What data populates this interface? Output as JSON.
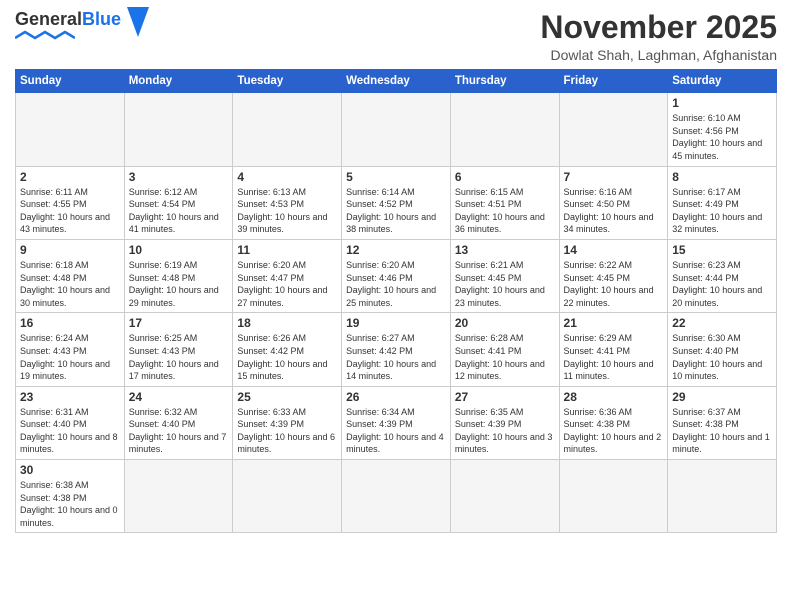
{
  "header": {
    "logo_text_regular": "General",
    "logo_text_blue": "Blue",
    "month_title": "November 2025",
    "subtitle": "Dowlat Shah, Laghman, Afghanistan"
  },
  "weekdays": [
    "Sunday",
    "Monday",
    "Tuesday",
    "Wednesday",
    "Thursday",
    "Friday",
    "Saturday"
  ],
  "weeks": [
    [
      {
        "day": "",
        "info": ""
      },
      {
        "day": "",
        "info": ""
      },
      {
        "day": "",
        "info": ""
      },
      {
        "day": "",
        "info": ""
      },
      {
        "day": "",
        "info": ""
      },
      {
        "day": "",
        "info": ""
      },
      {
        "day": "1",
        "info": "Sunrise: 6:10 AM\nSunset: 4:56 PM\nDaylight: 10 hours\nand 45 minutes."
      }
    ],
    [
      {
        "day": "2",
        "info": "Sunrise: 6:11 AM\nSunset: 4:55 PM\nDaylight: 10 hours\nand 43 minutes."
      },
      {
        "day": "3",
        "info": "Sunrise: 6:12 AM\nSunset: 4:54 PM\nDaylight: 10 hours\nand 41 minutes."
      },
      {
        "day": "4",
        "info": "Sunrise: 6:13 AM\nSunset: 4:53 PM\nDaylight: 10 hours\nand 39 minutes."
      },
      {
        "day": "5",
        "info": "Sunrise: 6:14 AM\nSunset: 4:52 PM\nDaylight: 10 hours\nand 38 minutes."
      },
      {
        "day": "6",
        "info": "Sunrise: 6:15 AM\nSunset: 4:51 PM\nDaylight: 10 hours\nand 36 minutes."
      },
      {
        "day": "7",
        "info": "Sunrise: 6:16 AM\nSunset: 4:50 PM\nDaylight: 10 hours\nand 34 minutes."
      },
      {
        "day": "8",
        "info": "Sunrise: 6:17 AM\nSunset: 4:49 PM\nDaylight: 10 hours\nand 32 minutes."
      }
    ],
    [
      {
        "day": "9",
        "info": "Sunrise: 6:18 AM\nSunset: 4:48 PM\nDaylight: 10 hours\nand 30 minutes."
      },
      {
        "day": "10",
        "info": "Sunrise: 6:19 AM\nSunset: 4:48 PM\nDaylight: 10 hours\nand 29 minutes."
      },
      {
        "day": "11",
        "info": "Sunrise: 6:20 AM\nSunset: 4:47 PM\nDaylight: 10 hours\nand 27 minutes."
      },
      {
        "day": "12",
        "info": "Sunrise: 6:20 AM\nSunset: 4:46 PM\nDaylight: 10 hours\nand 25 minutes."
      },
      {
        "day": "13",
        "info": "Sunrise: 6:21 AM\nSunset: 4:45 PM\nDaylight: 10 hours\nand 23 minutes."
      },
      {
        "day": "14",
        "info": "Sunrise: 6:22 AM\nSunset: 4:45 PM\nDaylight: 10 hours\nand 22 minutes."
      },
      {
        "day": "15",
        "info": "Sunrise: 6:23 AM\nSunset: 4:44 PM\nDaylight: 10 hours\nand 20 minutes."
      }
    ],
    [
      {
        "day": "16",
        "info": "Sunrise: 6:24 AM\nSunset: 4:43 PM\nDaylight: 10 hours\nand 19 minutes."
      },
      {
        "day": "17",
        "info": "Sunrise: 6:25 AM\nSunset: 4:43 PM\nDaylight: 10 hours\nand 17 minutes."
      },
      {
        "day": "18",
        "info": "Sunrise: 6:26 AM\nSunset: 4:42 PM\nDaylight: 10 hours\nand 15 minutes."
      },
      {
        "day": "19",
        "info": "Sunrise: 6:27 AM\nSunset: 4:42 PM\nDaylight: 10 hours\nand 14 minutes."
      },
      {
        "day": "20",
        "info": "Sunrise: 6:28 AM\nSunset: 4:41 PM\nDaylight: 10 hours\nand 12 minutes."
      },
      {
        "day": "21",
        "info": "Sunrise: 6:29 AM\nSunset: 4:41 PM\nDaylight: 10 hours\nand 11 minutes."
      },
      {
        "day": "22",
        "info": "Sunrise: 6:30 AM\nSunset: 4:40 PM\nDaylight: 10 hours\nand 10 minutes."
      }
    ],
    [
      {
        "day": "23",
        "info": "Sunrise: 6:31 AM\nSunset: 4:40 PM\nDaylight: 10 hours\nand 8 minutes."
      },
      {
        "day": "24",
        "info": "Sunrise: 6:32 AM\nSunset: 4:40 PM\nDaylight: 10 hours\nand 7 minutes."
      },
      {
        "day": "25",
        "info": "Sunrise: 6:33 AM\nSunset: 4:39 PM\nDaylight: 10 hours\nand 6 minutes."
      },
      {
        "day": "26",
        "info": "Sunrise: 6:34 AM\nSunset: 4:39 PM\nDaylight: 10 hours\nand 4 minutes."
      },
      {
        "day": "27",
        "info": "Sunrise: 6:35 AM\nSunset: 4:39 PM\nDaylight: 10 hours\nand 3 minutes."
      },
      {
        "day": "28",
        "info": "Sunrise: 6:36 AM\nSunset: 4:38 PM\nDaylight: 10 hours\nand 2 minutes."
      },
      {
        "day": "29",
        "info": "Sunrise: 6:37 AM\nSunset: 4:38 PM\nDaylight: 10 hours\nand 1 minute."
      }
    ],
    [
      {
        "day": "30",
        "info": "Sunrise: 6:38 AM\nSunset: 4:38 PM\nDaylight: 10 hours\nand 0 minutes."
      },
      {
        "day": "",
        "info": ""
      },
      {
        "day": "",
        "info": ""
      },
      {
        "day": "",
        "info": ""
      },
      {
        "day": "",
        "info": ""
      },
      {
        "day": "",
        "info": ""
      },
      {
        "day": "",
        "info": ""
      }
    ]
  ]
}
